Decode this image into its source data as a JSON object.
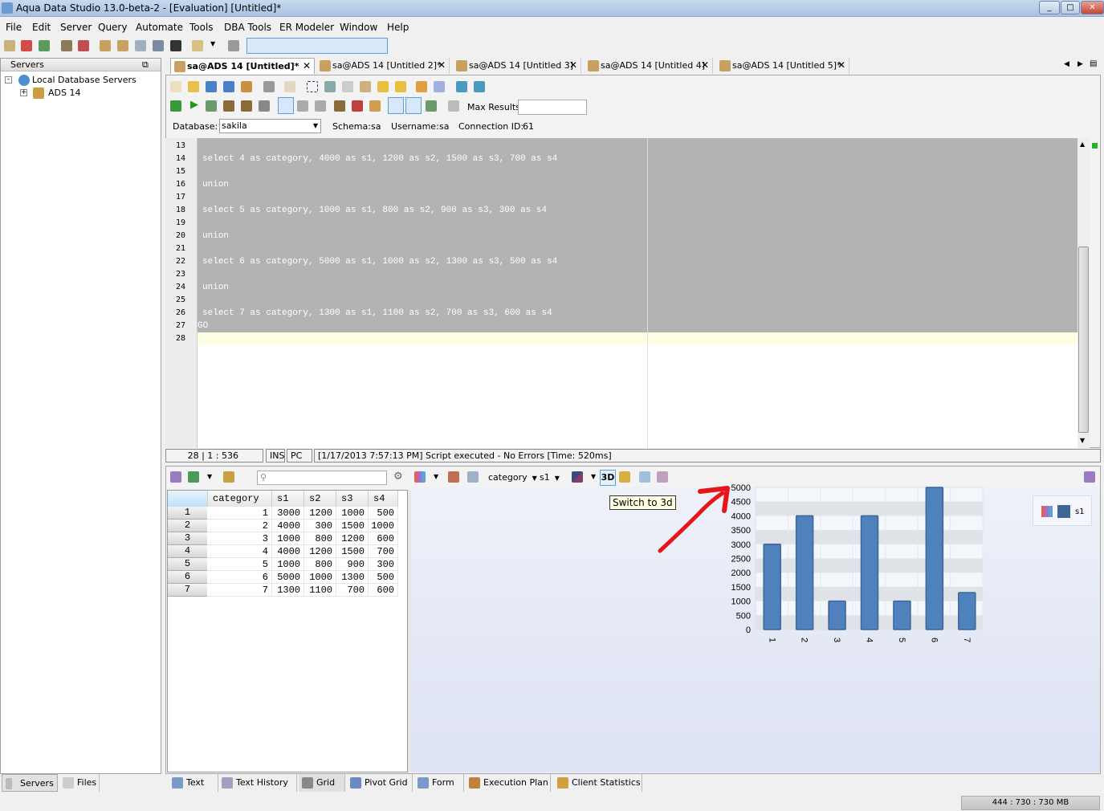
{
  "window": {
    "title": "Aqua Data Studio 13.0-beta-2 - [Evaluation] [Untitled]*"
  },
  "menu": [
    "File",
    "Edit",
    "Server",
    "Query",
    "Automate",
    "Tools",
    "DBA Tools",
    "ER Modeler",
    "Window",
    "Help"
  ],
  "servers_panel": {
    "title": "Servers",
    "tree": [
      {
        "label": "Local Database Servers"
      },
      {
        "label": "ADS 14"
      }
    ],
    "bottom_tabs": [
      "Servers",
      "Files"
    ]
  },
  "editor_tabs": [
    {
      "label": "sa@ADS 14 [Untitled]*",
      "active": true
    },
    {
      "label": "sa@ADS 14 [Untitled 2]*"
    },
    {
      "label": "sa@ADS 14 [Untitled 3]"
    },
    {
      "label": "sa@ADS 14 [Untitled 4]"
    },
    {
      "label": "sa@ADS 14 [Untitled 5]*"
    }
  ],
  "query_toolbar": {
    "max_results_label": "Max Results:",
    "max_results_value": "",
    "database_label": "Database:",
    "database_value": "sakila",
    "schema_label": "Schema:",
    "schema_value": "sa",
    "username_label": "Username:",
    "username_value": "sa",
    "connection_label": "Connection ID:",
    "connection_value": "61"
  },
  "editor": {
    "lines": [
      {
        "n": "13",
        "text": ""
      },
      {
        "n": "14",
        "text": "select 4 as category, 4000 as s1, 1200 as s2, 1500 as s3, 700 as s4"
      },
      {
        "n": "15",
        "text": ""
      },
      {
        "n": "16",
        "text": "union"
      },
      {
        "n": "17",
        "text": ""
      },
      {
        "n": "18",
        "text": "select 5 as category, 1000 as s1, 800 as s2, 900 as s3, 300 as s4"
      },
      {
        "n": "19",
        "text": ""
      },
      {
        "n": "20",
        "text": "union"
      },
      {
        "n": "21",
        "text": ""
      },
      {
        "n": "22",
        "text": "select 6 as category, 5000 as s1, 1000 as s2, 1300 as s3, 500 as s4"
      },
      {
        "n": "23",
        "text": ""
      },
      {
        "n": "24",
        "text": "union"
      },
      {
        "n": "25",
        "text": ""
      },
      {
        "n": "26",
        "text": "select 7 as category, 1300 as s1, 1100 as s2, 700 as s3, 600 as s4"
      },
      {
        "n": "27",
        "text": "GO"
      },
      {
        "n": "28",
        "text": ""
      }
    ]
  },
  "status": {
    "position": "28 | 1 : 536",
    "mode": "INS",
    "platform": "PC",
    "message": "[1/17/2013 7:57:13 PM] Script executed - No Errors [Time: 520ms]"
  },
  "results_toolbar": {
    "search_placeholder": "",
    "x_axis_select": "category",
    "y_axis_select": "s1",
    "btn_3d": "3D",
    "tooltip": "Switch to 3d"
  },
  "grid": {
    "columns": [
      "category",
      "s1",
      "s2",
      "s3",
      "s4"
    ],
    "rows": [
      [
        "1",
        "1",
        "3000",
        "1200",
        "1000",
        "500"
      ],
      [
        "2",
        "2",
        "4000",
        "300",
        "1500",
        "1000"
      ],
      [
        "3",
        "3",
        "1000",
        "800",
        "1200",
        "600"
      ],
      [
        "4",
        "4",
        "4000",
        "1200",
        "1500",
        "700"
      ],
      [
        "5",
        "5",
        "1000",
        "800",
        "900",
        "300"
      ],
      [
        "6",
        "6",
        "5000",
        "1000",
        "1300",
        "500"
      ],
      [
        "7",
        "7",
        "1300",
        "1100",
        "700",
        "600"
      ]
    ]
  },
  "chart_data": {
    "type": "bar",
    "categories": [
      "1",
      "2",
      "3",
      "4",
      "5",
      "6",
      "7"
    ],
    "series": [
      {
        "name": "s1",
        "values": [
          3000,
          4000,
          1000,
          4000,
          1000,
          5000,
          1300
        ]
      }
    ],
    "ylim": [
      0,
      5000
    ],
    "yticks": [
      "0",
      "500",
      "1000",
      "1500",
      "2000",
      "2500",
      "3000",
      "3500",
      "4000",
      "4500",
      "5000"
    ],
    "grid": true,
    "legend": "top-right",
    "bar_color": "#4f81bd"
  },
  "result_tabs": [
    "Text",
    "Text History",
    "Grid",
    "Pivot Grid",
    "Form",
    "Execution Plan",
    "Client Statistics"
  ],
  "memory": "444 : 730 : 730 MB",
  "colors": {
    "annotation": "#e8141c",
    "selection": "#b3b3b3",
    "current_line": "#fefee6"
  }
}
